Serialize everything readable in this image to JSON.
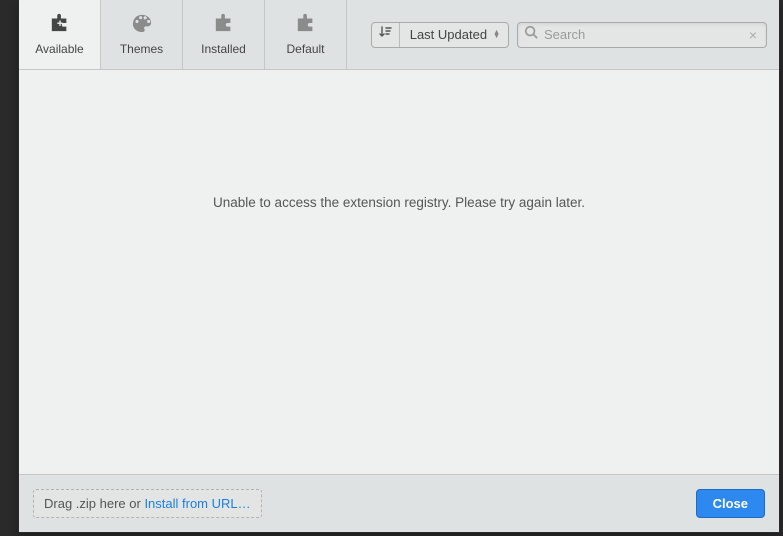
{
  "tabs": {
    "available": "Available",
    "themes": "Themes",
    "installed": "Installed",
    "default": "Default"
  },
  "sort": {
    "label": "Last Updated"
  },
  "search": {
    "placeholder": "Search"
  },
  "message": "Unable to access the extension registry. Please try again later.",
  "footer": {
    "drag_prefix": "Drag .zip here or ",
    "install_link": "Install from URL…"
  },
  "close_label": "Close"
}
